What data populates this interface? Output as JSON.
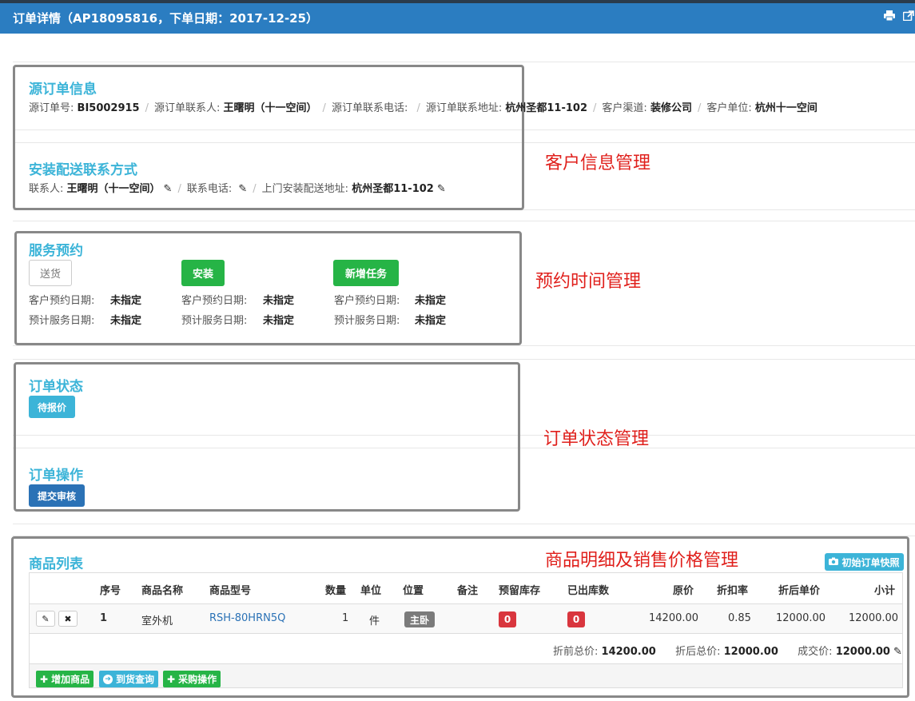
{
  "header": {
    "title": "订单详情（AP18095816，下单日期：2017-12-25）",
    "print_icon": "print-icon",
    "export_icon": "external-link-icon"
  },
  "source_order": {
    "title": "源订单信息",
    "fields": [
      {
        "label": "源订单号:",
        "value": "BI5002915"
      },
      {
        "label": "源订单联系人:",
        "value": "王曙明（十一空间）"
      },
      {
        "label": "源订单联系电话:",
        "value": ""
      },
      {
        "label": "源订单联系地址:",
        "value": "杭州圣都11-102"
      },
      {
        "label": "客户渠道:",
        "value": "装修公司"
      },
      {
        "label": "客户单位:",
        "value": "杭州十一空间"
      }
    ]
  },
  "delivery_contact": {
    "title": "安装配送联系方式",
    "fields": [
      {
        "label": "联系人:",
        "value": "王曙明（十一空间）"
      },
      {
        "label": "联系电话:",
        "value": ""
      },
      {
        "label": "上门安装配送地址:",
        "value": "杭州圣都11-102"
      }
    ]
  },
  "service_booking": {
    "title": "服务预约",
    "columns": [
      {
        "button": "送货",
        "customer_date_label": "客户预约日期:",
        "customer_date": "未指定",
        "service_date_label": "预计服务日期:",
        "service_date": "未指定"
      },
      {
        "button": "安装",
        "customer_date_label": "客户预约日期:",
        "customer_date": "未指定",
        "service_date_label": "预计服务日期:",
        "service_date": "未指定"
      },
      {
        "button": "新增任务",
        "customer_date_label": "客户预约日期:",
        "customer_date": "未指定",
        "service_date_label": "预计服务日期:",
        "service_date": "未指定"
      }
    ]
  },
  "order_status": {
    "title": "订单状态",
    "status": "待报价"
  },
  "order_ops": {
    "title": "订单操作",
    "submit": "提交审核"
  },
  "products": {
    "title": "商品列表",
    "snapshot_button": "初始订单快照",
    "headers": [
      "序号",
      "商品名称",
      "商品型号",
      "数量",
      "单位",
      "位置",
      "备注",
      "预留库存",
      "已出库数",
      "原价",
      "折扣率",
      "折后单价",
      "小计"
    ],
    "row": {
      "index": "1",
      "name": "室外机",
      "model": "RSH-80HRN5Q",
      "qty": "1",
      "unit": "件",
      "location": "主卧",
      "note": "",
      "reserved": "0",
      "shipped": "0",
      "price": "14200.00",
      "discount": "0.85",
      "discounted_price": "12000.00",
      "subtotal": "12000.00"
    },
    "totals": {
      "pre_label": "折前总价:",
      "pre_value": "14200.00",
      "post_label": "折后总价:",
      "post_value": "12000.00",
      "deal_label": "成交价:",
      "deal_value": "12000.00"
    },
    "actions": {
      "add": "增加商品",
      "arrival": "到货查询",
      "purchase": "采购操作"
    }
  },
  "annotations": {
    "customer": "客户信息管理",
    "booking": "预约时间管理",
    "status": "订单状态管理",
    "products": "商品明细及销售价格管理"
  },
  "colors": {
    "header_bg": "#2b7dc1",
    "section_title": "#3cb4d8",
    "success": "#26b446",
    "primary": "#2b72b6",
    "danger": "#d9363e",
    "annotation": "#e0201c"
  }
}
